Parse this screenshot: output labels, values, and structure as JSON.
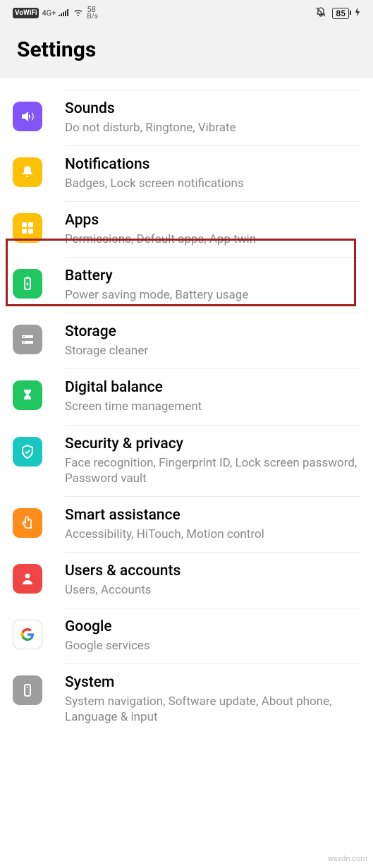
{
  "status": {
    "vowifi": "VoWiFi",
    "network": "4G+",
    "speed_value": "58",
    "speed_unit": "B/s",
    "battery": "85"
  },
  "header": {
    "title": "Settings"
  },
  "items": [
    {
      "id": "sounds",
      "title": "Sounds",
      "sub": "Do not disturb, Ringtone, Vibrate"
    },
    {
      "id": "notifications",
      "title": "Notifications",
      "sub": "Badges, Lock screen notifications"
    },
    {
      "id": "apps",
      "title": "Apps",
      "sub": "Permissions, Default apps, App twin"
    },
    {
      "id": "battery",
      "title": "Battery",
      "sub": "Power saving mode, Battery usage"
    },
    {
      "id": "storage",
      "title": "Storage",
      "sub": "Storage cleaner"
    },
    {
      "id": "digital-balance",
      "title": "Digital balance",
      "sub": "Screen time management"
    },
    {
      "id": "security",
      "title": "Security & privacy",
      "sub": "Face recognition, Fingerprint ID, Lock screen password, Password vault"
    },
    {
      "id": "smart-assistance",
      "title": "Smart assistance",
      "sub": "Accessibility, HiTouch, Motion control"
    },
    {
      "id": "users-accounts",
      "title": "Users & accounts",
      "sub": "Users, Accounts"
    },
    {
      "id": "google",
      "title": "Google",
      "sub": "Google services"
    },
    {
      "id": "system",
      "title": "System",
      "sub": "System navigation, Software update, About phone, Language & input"
    }
  ],
  "highlighted_item_id": "apps",
  "watermark": "wsxdn.com"
}
